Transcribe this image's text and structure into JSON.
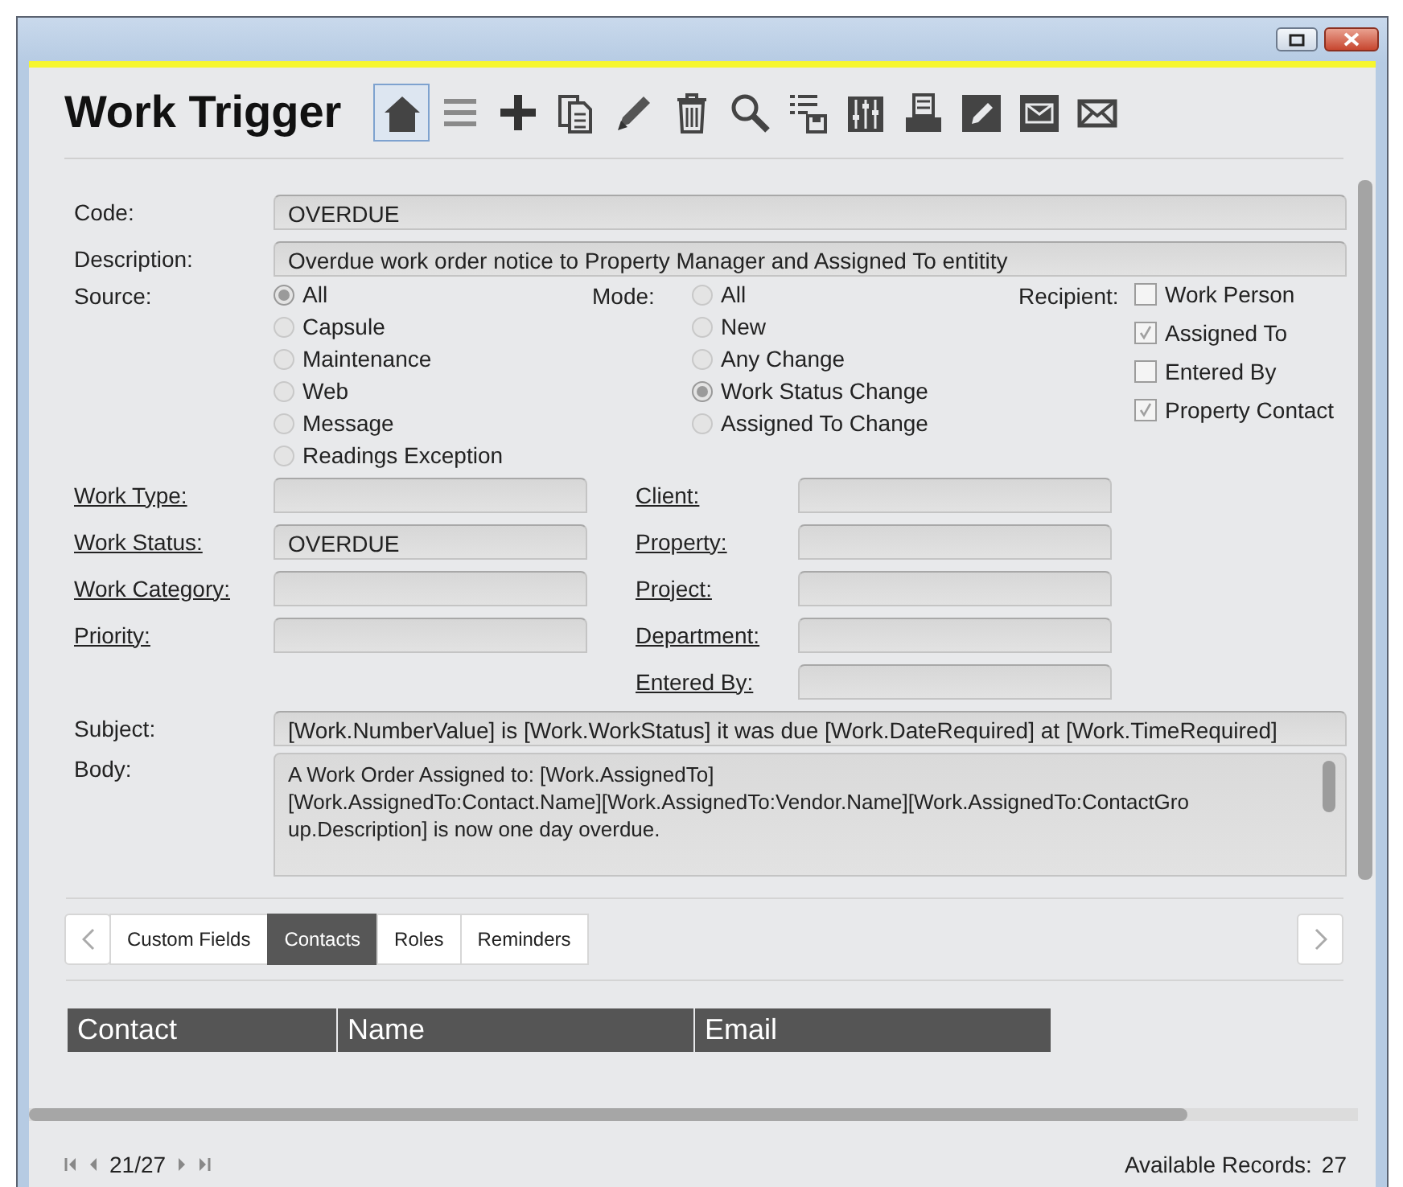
{
  "window": {
    "title": "Work Trigger"
  },
  "toolbar": [
    {
      "kind": "home",
      "selected": true
    },
    {
      "kind": "list",
      "selected": false
    },
    {
      "kind": "add",
      "selected": false
    },
    {
      "kind": "copy",
      "selected": false
    },
    {
      "kind": "edit",
      "selected": false
    },
    {
      "kind": "delete",
      "selected": false
    },
    {
      "kind": "search",
      "selected": false
    },
    {
      "kind": "export",
      "selected": false
    },
    {
      "kind": "sliders",
      "selected": false
    },
    {
      "kind": "print",
      "selected": false
    },
    {
      "kind": "note",
      "selected": false
    },
    {
      "kind": "mailbox",
      "selected": false
    },
    {
      "kind": "mail",
      "selected": false
    }
  ],
  "form": {
    "code": {
      "label": "Code:",
      "value": "OVERDUE"
    },
    "description": {
      "label": "Description:",
      "value": "Overdue work order notice to Property Manager and Assigned To entitity"
    },
    "source": {
      "label": "Source:",
      "options": [
        {
          "label": "All",
          "selected": true
        },
        {
          "label": "Capsule",
          "selected": false
        },
        {
          "label": "Maintenance",
          "selected": false
        },
        {
          "label": "Web",
          "selected": false
        },
        {
          "label": "Message",
          "selected": false
        },
        {
          "label": "Readings Exception",
          "selected": false
        }
      ]
    },
    "mode": {
      "label": "Mode:",
      "options": [
        {
          "label": "All",
          "selected": false
        },
        {
          "label": "New",
          "selected": false
        },
        {
          "label": "Any Change",
          "selected": false
        },
        {
          "label": "Work Status Change",
          "selected": true
        },
        {
          "label": "Assigned To Change",
          "selected": false
        }
      ]
    },
    "recipient": {
      "label": "Recipient:",
      "options": [
        {
          "label": "Work Person",
          "checked": false
        },
        {
          "label": "Assigned To",
          "checked": true
        },
        {
          "label": "Entered By",
          "checked": false
        },
        {
          "label": "Property Contact",
          "checked": true
        }
      ]
    },
    "left_lookups": [
      {
        "label": "Work Type:"
      },
      {
        "label": "Work Status:",
        "value": "OVERDUE"
      },
      {
        "label": "Work Category:"
      },
      {
        "label": "Priority:"
      }
    ],
    "right_lookups": [
      {
        "label": "Client:"
      },
      {
        "label": "Property:"
      },
      {
        "label": "Project:"
      },
      {
        "label": "Department:"
      },
      {
        "label": "Entered By:"
      }
    ],
    "subject": {
      "label": "Subject:",
      "value": "[Work.NumberValue] is [Work.WorkStatus] it was due [Work.DateRequired] at [Work.TimeRequired]"
    },
    "body": {
      "label": "Body:",
      "lines": [
        "A Work Order Assigned to: [Work.AssignedTo]",
        "[Work.AssignedTo:Contact.Name][Work.AssignedTo:Vendor.Name][Work.AssignedTo:ContactGro",
        "up.Description] is now one day overdue."
      ]
    }
  },
  "tabs": [
    {
      "label": "Custom Fields",
      "selected": false
    },
    {
      "label": "Contacts",
      "selected": true
    },
    {
      "label": "Roles",
      "selected": false
    },
    {
      "label": "Reminders",
      "selected": false
    }
  ],
  "table": {
    "columns": [
      "Contact",
      "Name",
      "Email"
    ]
  },
  "pager": {
    "position": "21/27"
  },
  "status": {
    "label": "Available Records:",
    "count": "27"
  }
}
